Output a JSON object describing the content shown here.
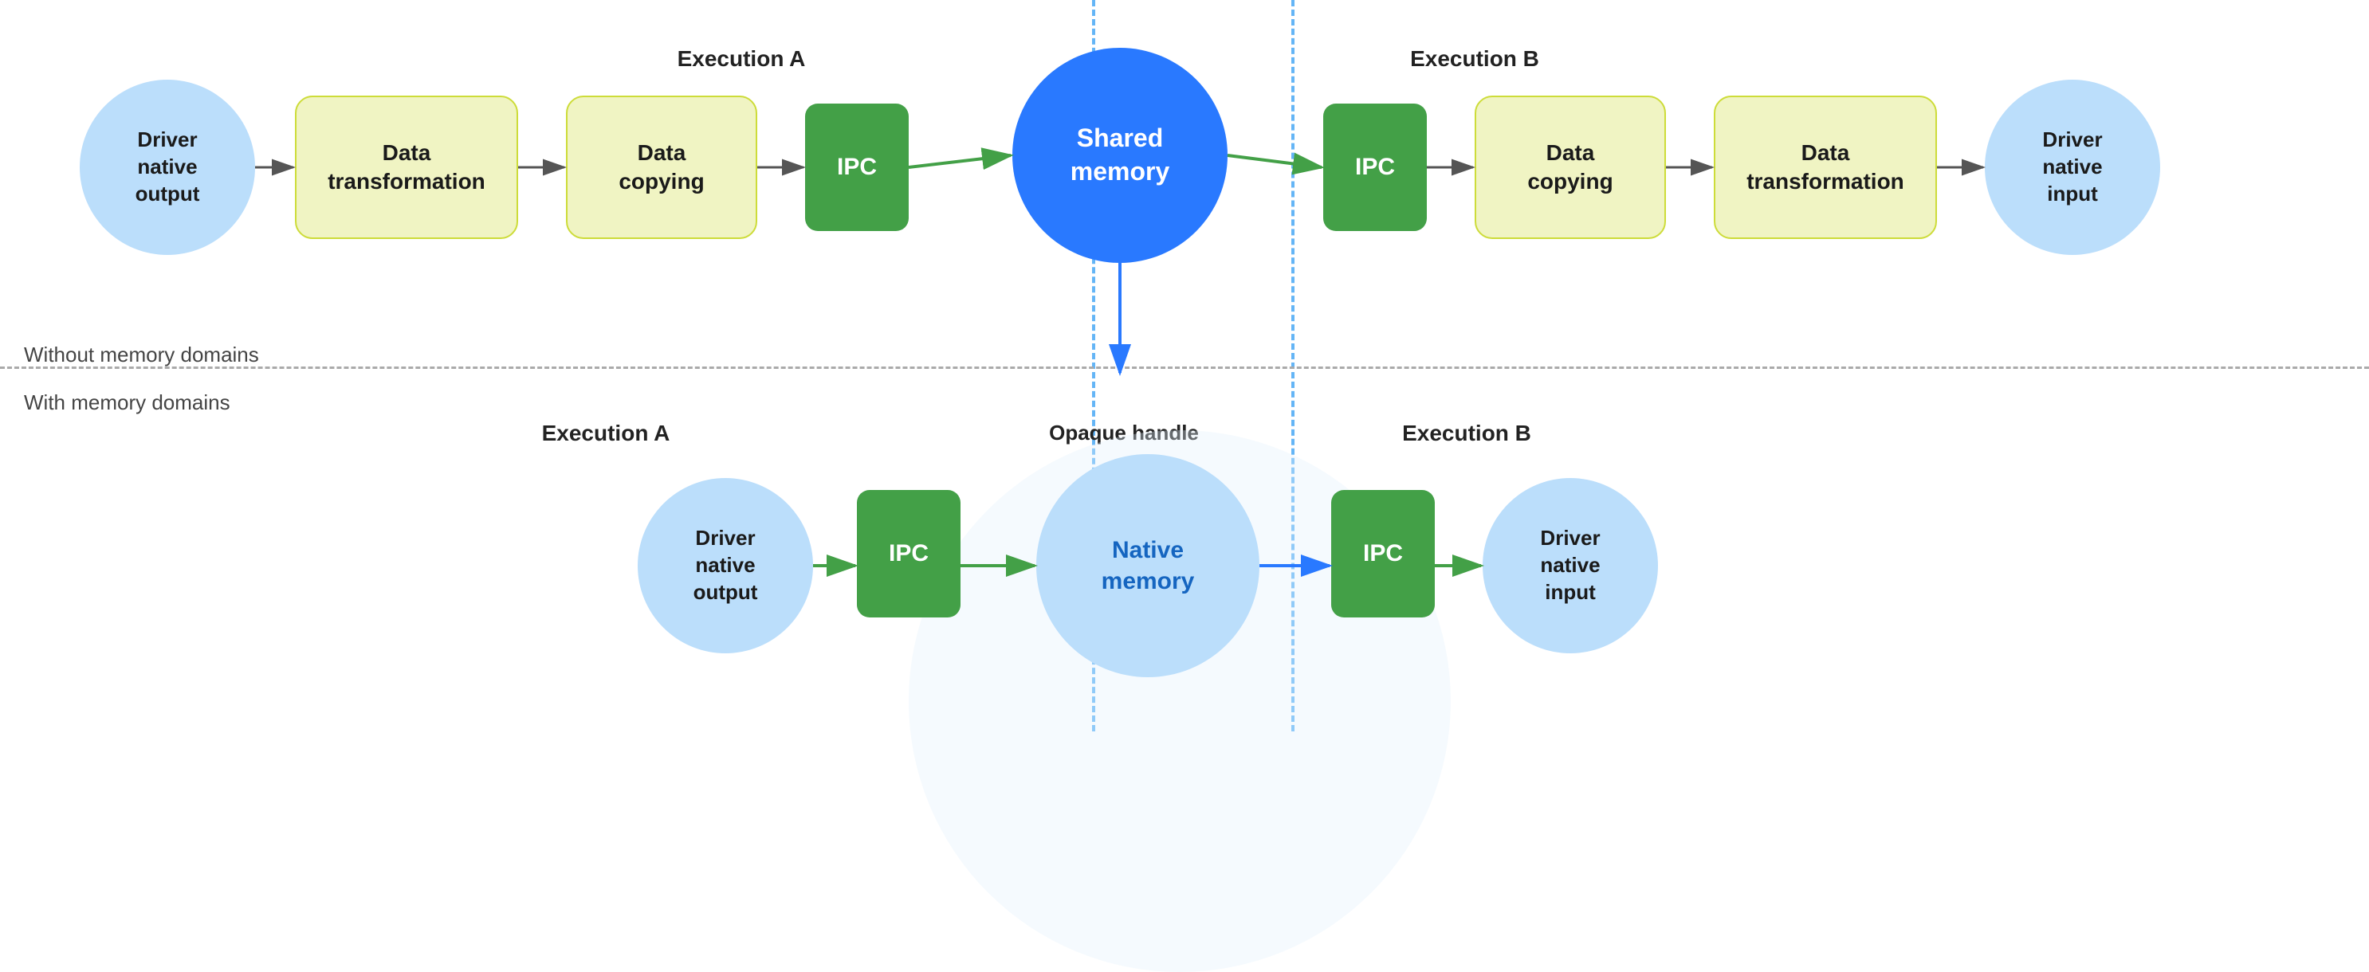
{
  "sections": {
    "without": "Without memory domains",
    "with": "With memory domains"
  },
  "top_row": {
    "exec_a_label": "Execution A",
    "exec_b_label": "Execution B",
    "nodes": [
      {
        "id": "driver-native-output-top",
        "label": "Driver\nnative\noutput",
        "type": "circle-light"
      },
      {
        "id": "data-transform-1",
        "label": "Data\ntransformation",
        "type": "rect-yellow"
      },
      {
        "id": "data-copy-1",
        "label": "Data\ncopying",
        "type": "rect-yellow"
      },
      {
        "id": "ipc-1",
        "label": "IPC",
        "type": "rect-green"
      },
      {
        "id": "shared-memory",
        "label": "Shared\nmemory",
        "type": "circle-blue"
      },
      {
        "id": "ipc-2",
        "label": "IPC",
        "type": "rect-green"
      },
      {
        "id": "data-copy-2",
        "label": "Data\ncopying",
        "type": "rect-yellow"
      },
      {
        "id": "data-transform-2",
        "label": "Data\ntransformation",
        "type": "rect-yellow"
      },
      {
        "id": "driver-native-input-top",
        "label": "Driver\nnative\ninput",
        "type": "circle-light"
      }
    ]
  },
  "bottom_row": {
    "exec_a_label": "Execution A",
    "exec_b_label": "Execution B",
    "opaque_label": "Opaque handle",
    "nodes": [
      {
        "id": "driver-native-output-bot",
        "label": "Driver\nnative\noutput",
        "type": "circle-light"
      },
      {
        "id": "ipc-3",
        "label": "IPC",
        "type": "rect-green"
      },
      {
        "id": "native-memory",
        "label": "Native\nmemory",
        "type": "circle-pale-blue"
      },
      {
        "id": "ipc-4",
        "label": "IPC",
        "type": "rect-green"
      },
      {
        "id": "driver-native-input-bot",
        "label": "Driver\nnative\ninput",
        "type": "circle-light"
      }
    ]
  },
  "colors": {
    "vline": "#64B5F6",
    "arrow_green": "#43A047",
    "arrow_blue": "#2979FF",
    "arrow_dark": "#444"
  }
}
